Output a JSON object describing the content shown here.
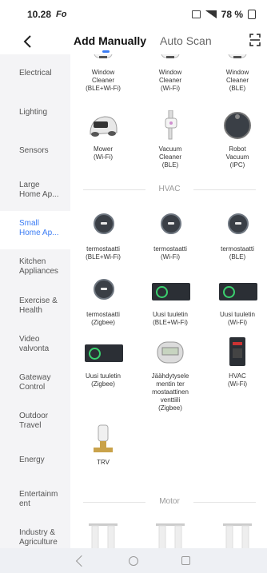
{
  "status": {
    "time": "10.28",
    "carrier": "Fo",
    "battery": "78 %"
  },
  "tabs": {
    "manual": "Add Manually",
    "auto": "Auto Scan"
  },
  "sidebar": {
    "items": [
      {
        "label": "Electrical",
        "active": false
      },
      {
        "label": "Lighting",
        "active": false
      },
      {
        "label": "Sensors",
        "active": false
      },
      {
        "label": "Large\nHome Ap...",
        "active": false
      },
      {
        "label": "Small\nHome Ap...",
        "active": true
      },
      {
        "label": "Kitchen\nAppliances",
        "active": false
      },
      {
        "label": "Exercise &\nHealth",
        "active": false
      },
      {
        "label": "Video\nvalvonta",
        "active": false
      },
      {
        "label": "Gateway\nControl",
        "active": false
      },
      {
        "label": "Outdoor\nTravel",
        "active": false
      },
      {
        "label": "Energy",
        "active": false
      },
      {
        "label": "Entertainm\nent",
        "active": false
      },
      {
        "label": "Industry &\nAgriculture",
        "active": false
      }
    ]
  },
  "devices_top": [
    {
      "label": "Window\nCleaner\n(BLE+Wi-Fi)",
      "icon": "window-cleaner-icon"
    },
    {
      "label": "Window\nCleaner\n(Wi-Fi)",
      "icon": "window-cleaner-icon"
    },
    {
      "label": "Window\nCleaner\n(BLE)",
      "icon": "window-cleaner-icon"
    },
    {
      "label": "Mower\n(Wi-Fi)",
      "icon": "mower-icon"
    },
    {
      "label": "Vacuum\nCleaner\n(BLE)",
      "icon": "handheld-vacuum-icon"
    },
    {
      "label": "Robot\nVacuum\n(IPC)",
      "icon": "robot-vacuum-icon"
    }
  ],
  "section_hvac": "HVAC",
  "devices_hvac": [
    {
      "label": "termostaatti\n(BLE+Wi-Fi)",
      "icon": "thermostat-icon"
    },
    {
      "label": "termostaatti\n(Wi-Fi)",
      "icon": "thermostat-icon"
    },
    {
      "label": "termostaatti\n(BLE)",
      "icon": "thermostat-icon"
    },
    {
      "label": "termostaatti\n(Zigbee)",
      "icon": "thermostat-icon"
    },
    {
      "label": "Uusi tuuletin\n(BLE+Wi-Fi)",
      "icon": "fan-panel-icon"
    },
    {
      "label": "Uusi tuuletin\n(Wi-Fi)",
      "icon": "fan-panel-icon"
    },
    {
      "label": "Uusi tuuletin\n(Zigbee)",
      "icon": "fan-panel-icon"
    },
    {
      "label": "Jäähdytysele\nmentin ter\nmostaattinen\nventtiili\n(Zigbee)",
      "icon": "radiator-valve-icon"
    },
    {
      "label": "HVAC\n(Wi-Fi)",
      "icon": "hvac-panel-icon"
    },
    {
      "label": "TRV",
      "icon": "trv-icon"
    }
  ],
  "section_motor": "Motor",
  "colors": {
    "accent": "#3b7cf4",
    "sidebar_bg": "#f4f4f6",
    "navbar_bg": "#eef0f4"
  }
}
